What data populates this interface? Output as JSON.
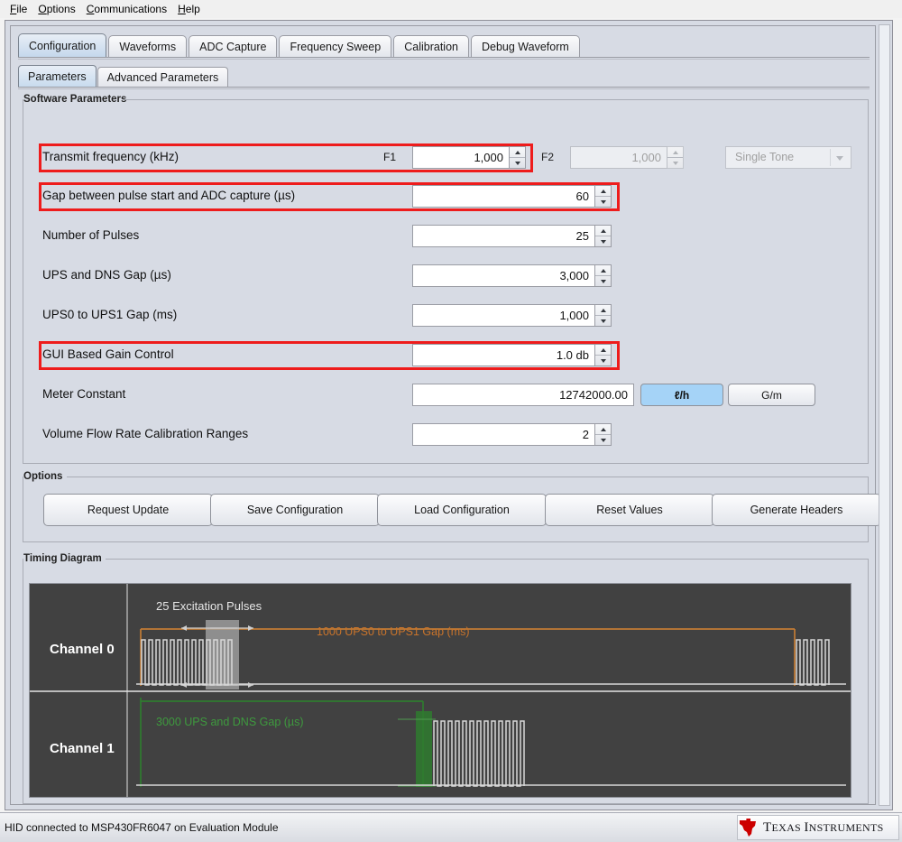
{
  "menubar": {
    "items": [
      {
        "label": "File",
        "mnemonic": "F"
      },
      {
        "label": "Options",
        "mnemonic": "O"
      },
      {
        "label": "Communications",
        "mnemonic": "C"
      },
      {
        "label": "Help",
        "mnemonic": "H"
      }
    ]
  },
  "tabs": {
    "main": [
      {
        "label": "Configuration",
        "active": true
      },
      {
        "label": "Waveforms",
        "active": false
      },
      {
        "label": "ADC Capture",
        "active": false
      },
      {
        "label": "Frequency Sweep",
        "active": false
      },
      {
        "label": "Calibration",
        "active": false
      },
      {
        "label": "Debug Waveform",
        "active": false
      }
    ],
    "sub": [
      {
        "label": "Parameters",
        "active": true
      },
      {
        "label": "Advanced Parameters",
        "active": false
      }
    ]
  },
  "groups": {
    "software_parameters": "Software Parameters",
    "options": "Options",
    "timing_diagram": "Timing Diagram"
  },
  "parameters": [
    {
      "label": "Transmit frequency (kHz)",
      "f1_tag": "F1",
      "f1_value": "1,000",
      "f2_tag": "F2",
      "f2_value": "1,000",
      "f2_disabled": true,
      "tone_mode": "Single Tone",
      "tone_disabled": true,
      "highlighted": true
    },
    {
      "label": "Gap between pulse start and ADC capture (µs)",
      "value": "60",
      "highlighted": true
    },
    {
      "label": "Number of Pulses",
      "value": "25",
      "highlighted": false
    },
    {
      "label": "UPS and DNS Gap (µs)",
      "value": "3,000",
      "highlighted": false
    },
    {
      "label": "UPS0 to UPS1 Gap (ms)",
      "value": "1,000",
      "highlighted": false
    },
    {
      "label": "GUI Based Gain Control",
      "value": "1.0 db",
      "highlighted": true
    },
    {
      "label": "Meter Constant",
      "value": "12742000.00",
      "unit_buttons": [
        {
          "label": "ℓ/h",
          "selected": true
        },
        {
          "label": "G/m",
          "selected": false
        }
      ],
      "highlighted": false
    },
    {
      "label": "Volume Flow Rate Calibration Ranges",
      "value": "2",
      "highlighted": false
    }
  ],
  "option_buttons": [
    {
      "label": "Request Update"
    },
    {
      "label": "Save Configuration"
    },
    {
      "label": "Load Configuration"
    },
    {
      "label": "Reset Values"
    },
    {
      "label": "Generate Headers"
    }
  ],
  "timing": {
    "channel0_label": "Channel 0",
    "channel1_label": "Channel 1",
    "pulses_annotation": "25 Excitation Pulses",
    "ups0_annotation": "1000 UPS0 to UPS1 Gap (ms)",
    "ups_dns_annotation": "3000 UPS and DNS Gap (µs)",
    "colors": {
      "background": "#414141",
      "waveform": "#d8d8d8",
      "ups0_gap": "#c27c35",
      "ups_dns_gap": "#2f7b2f",
      "adc_window": "#a8a8a8"
    }
  },
  "statusbar": {
    "text": "HID connected to MSP430FR6047 on Evaluation Module",
    "logo_text_1": "T",
    "logo_text_2": "EXAS ",
    "logo_text_3": "I",
    "logo_text_4": "NSTRUMENTS"
  },
  "colors": {
    "window_bg": "#d7dbe4",
    "highlight_red": "#ee1c1c",
    "accent_blue": "#a5d3f7"
  }
}
